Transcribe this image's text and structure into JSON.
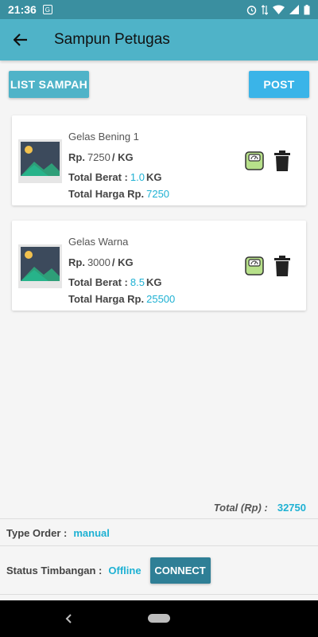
{
  "status_bar": {
    "time": "21:36"
  },
  "header": {
    "title": "Sampun Petugas"
  },
  "actions": {
    "list_label": "LIST SAMPAH",
    "post_label": "POST"
  },
  "items": [
    {
      "name": "Gelas Bening 1",
      "price_prefix": "Rp.",
      "price": "7250",
      "price_unit": "/ KG",
      "weight_label": "Total Berat :",
      "weight": "1.0",
      "weight_unit": "KG",
      "total_label": "Total Harga Rp.",
      "total": "7250"
    },
    {
      "name": "Gelas Warna",
      "price_prefix": "Rp.",
      "price": "3000",
      "price_unit": "/ KG",
      "weight_label": "Total Berat :",
      "weight": "8.5",
      "weight_unit": "KG",
      "total_label": "Total Harga Rp.",
      "total": "25500"
    }
  ],
  "summary": {
    "total_label": "Total (Rp) :",
    "total_value": "32750"
  },
  "order": {
    "type_label": "Type Order :",
    "type_value": "manual"
  },
  "scale": {
    "status_label": "Status Timbangan :",
    "status_value": "Offline",
    "connect_label": "CONNECT"
  },
  "colors": {
    "app_bar": "#4fb3c8",
    "status_bar": "#3a8fa0",
    "accent": "#1eb1d3",
    "post_button": "#3ab4e8",
    "connect_button": "#2f7f96"
  },
  "icons": {
    "thumbnail": "image-placeholder-icon",
    "scale": "weighing-scale-icon",
    "delete": "trash-icon"
  }
}
